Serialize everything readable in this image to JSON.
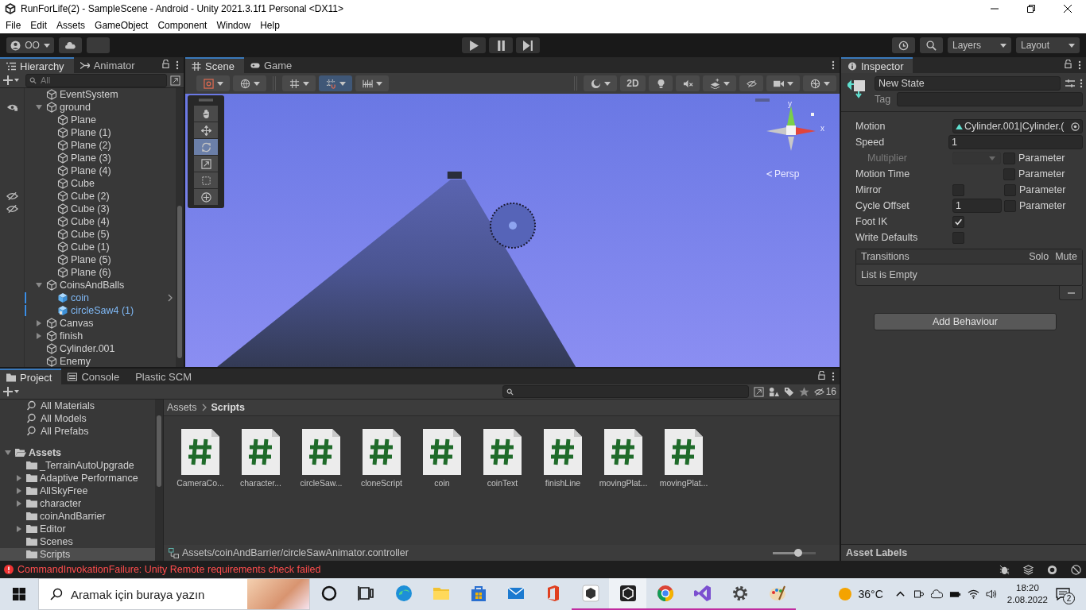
{
  "window": {
    "title": "RunForLife(2) - SampleScene - Android - Unity 2021.3.1f1 Personal <DX11>"
  },
  "menu": [
    "File",
    "Edit",
    "Assets",
    "GameObject",
    "Component",
    "Window",
    "Help"
  ],
  "toolbar": {
    "account": "OO",
    "layers": "Layers",
    "layout": "Layout"
  },
  "hierarchy": {
    "tabs": [
      {
        "label": "Hierarchy",
        "kind": "hierarchy",
        "selected": true
      },
      {
        "label": "Animator",
        "kind": "animator",
        "selected": false
      }
    ],
    "search": {
      "placeholder": "All"
    },
    "items": [
      {
        "name": "EventSystem",
        "kind": "object",
        "hidden": false
      },
      {
        "name": "ground",
        "kind": "object",
        "hidden": false,
        "expanded": true,
        "children": [
          {
            "name": "Plane",
            "kind": "object",
            "hidden": false
          },
          {
            "name": "Plane (1)",
            "kind": "object",
            "hidden": false
          },
          {
            "name": "Plane (2)",
            "kind": "object",
            "hidden": false
          },
          {
            "name": "Plane (3)",
            "kind": "object",
            "hidden": false
          },
          {
            "name": "Plane (4)",
            "kind": "object",
            "hidden": false
          },
          {
            "name": "Cube",
            "kind": "object",
            "hidden": false
          },
          {
            "name": "Cube (2)",
            "kind": "object",
            "hidden": true
          },
          {
            "name": "Cube (3)",
            "kind": "object",
            "hidden": true
          },
          {
            "name": "Cube (4)",
            "kind": "object",
            "hidden": false
          },
          {
            "name": "Cube (5)",
            "kind": "object",
            "hidden": false
          },
          {
            "name": "Cube (1)",
            "kind": "object",
            "hidden": false
          },
          {
            "name": "Plane (5)",
            "kind": "object",
            "hidden": false
          },
          {
            "name": "Plane (6)",
            "kind": "object",
            "hidden": false
          }
        ]
      },
      {
        "name": "CoinsAndBalls",
        "kind": "object",
        "hidden": false,
        "expanded": true,
        "children": [
          {
            "name": "coin",
            "kind": "prefab",
            "hidden": false
          },
          {
            "name": "circleSaw4 (1)",
            "kind": "prefab-variant",
            "hidden": false
          }
        ]
      },
      {
        "name": "Canvas",
        "kind": "object",
        "hidden": false,
        "expanded": false
      },
      {
        "name": "finish",
        "kind": "object",
        "hidden": false,
        "expanded": false
      },
      {
        "name": "Cylinder.001",
        "kind": "object",
        "hidden": false
      },
      {
        "name": "Enemy",
        "kind": "object",
        "hidden": false
      }
    ]
  },
  "scene": {
    "tabs": [
      {
        "label": "Scene",
        "kind": "scene",
        "selected": true
      },
      {
        "label": "Game",
        "kind": "game",
        "selected": false
      }
    ],
    "mode_2d": "2D",
    "toggles": {
      "lighting": false,
      "audio": false,
      "visibility": false
    },
    "tools": [
      {
        "kind": "hand",
        "selected": false
      },
      {
        "kind": "move",
        "selected": false
      },
      {
        "kind": "rotate",
        "selected": true
      },
      {
        "kind": "scale",
        "selected": false
      },
      {
        "kind": "rect",
        "selected": false
      },
      {
        "kind": "transform",
        "selected": false
      }
    ],
    "gizmo": {
      "y": "y",
      "x": "x",
      "projection": "Persp"
    }
  },
  "inspector": {
    "tab": "Inspector",
    "name": "New State",
    "tag_label": "Tag",
    "fields": [
      {
        "kind": "object",
        "label": "Motion",
        "value": "Cylinder.001|Cylinder.(",
        "disabled": false
      },
      {
        "kind": "number",
        "label": "Speed",
        "value": "1",
        "disabled": false
      },
      {
        "kind": "dropdown",
        "label": "Multiplier",
        "disabled": true,
        "parameter": {
          "label": "Parameter",
          "checked": false
        }
      },
      {
        "kind": "blank",
        "label": "Motion Time",
        "disabled": false,
        "parameter": {
          "label": "Parameter",
          "checked": false
        }
      },
      {
        "kind": "checkbox",
        "label": "Mirror",
        "checked": false,
        "disabled": false,
        "parameter": {
          "label": "Parameter",
          "checked": false
        }
      },
      {
        "kind": "short-number",
        "label": "Cycle Offset",
        "value": "1",
        "disabled": false,
        "parameter": {
          "label": "Parameter",
          "checked": false
        }
      },
      {
        "kind": "checkbox",
        "label": "Foot IK",
        "checked": true,
        "disabled": false
      },
      {
        "kind": "checkbox",
        "label": "Write Defaults",
        "checked": false,
        "disabled": false
      }
    ],
    "transitions": {
      "title": "Transitions",
      "solo": "Solo",
      "mute": "Mute",
      "empty": "List is Empty"
    },
    "add_button": "Add Behaviour",
    "asset_labels": "Asset Labels"
  },
  "project": {
    "tabs": [
      {
        "label": "Project",
        "kind": "project",
        "selected": true
      },
      {
        "label": "Console",
        "kind": "console",
        "selected": false
      },
      {
        "label": "Plastic SCM",
        "kind": "plastic",
        "selected": false
      }
    ],
    "hidden_count": "16",
    "sidebar": [
      {
        "name": "All Materials",
        "kind": "search",
        "selected": false
      },
      {
        "name": "All Models",
        "kind": "search",
        "selected": false
      },
      {
        "name": "All Prefabs",
        "kind": "search",
        "selected": false
      },
      {
        "name": "Assets",
        "kind": "folder",
        "selected": false,
        "expanded": true,
        "children": [
          {
            "name": "_TerrainAutoUpgrade",
            "kind": "folder",
            "selected": false
          },
          {
            "name": "Adaptive Performance",
            "kind": "folder",
            "selected": false,
            "expanded": false
          },
          {
            "name": "AllSkyFree",
            "kind": "folder",
            "selected": false,
            "expanded": false
          },
          {
            "name": "character",
            "kind": "folder",
            "selected": false,
            "expanded": false
          },
          {
            "name": "coinAndBarrier",
            "kind": "folder",
            "selected": false
          },
          {
            "name": "Editor",
            "kind": "folder",
            "selected": false,
            "expanded": false
          },
          {
            "name": "Scenes",
            "kind": "folder",
            "selected": false
          },
          {
            "name": "Scripts",
            "kind": "folder",
            "selected": true
          }
        ]
      }
    ],
    "breadcrumb": [
      "Assets",
      "Scripts"
    ],
    "files": [
      "CameraCo...",
      "character...",
      "circleSaw...",
      "cloneScript",
      "coin",
      "coinText",
      "finishLine",
      "movingPlat...",
      "movingPlat..."
    ],
    "path": "Assets/coinAndBarrier/circleSawAnimator.controller",
    "zoom": {
      "level": 0.6
    }
  },
  "status": {
    "message": "CommandInvokationFailure: Unity Remote requirements check failed"
  },
  "taskbar": {
    "search": {
      "placeholder": "Aramak için buraya yazın"
    },
    "apps": [
      {
        "kind": "cortana",
        "running": false,
        "active": false
      },
      {
        "kind": "task-view",
        "running": false,
        "active": false
      },
      {
        "kind": "edge",
        "running": false,
        "active": false
      },
      {
        "kind": "explorer",
        "running": false,
        "active": false
      },
      {
        "kind": "store",
        "running": false,
        "active": false
      },
      {
        "kind": "mail",
        "running": false,
        "active": false
      },
      {
        "kind": "office",
        "running": false,
        "active": false
      },
      {
        "kind": "unity-hub",
        "running": true,
        "active": false
      },
      {
        "kind": "unity",
        "running": true,
        "active": true
      },
      {
        "kind": "chrome",
        "running": true,
        "active": false
      },
      {
        "kind": "visual-studio",
        "running": true,
        "active": false
      },
      {
        "kind": "settings",
        "running": true,
        "active": false
      },
      {
        "kind": "paint",
        "running": true,
        "active": false
      }
    ],
    "weather": "36°C",
    "time": "18:20",
    "date": "2.08.2022",
    "notifications": "2"
  }
}
